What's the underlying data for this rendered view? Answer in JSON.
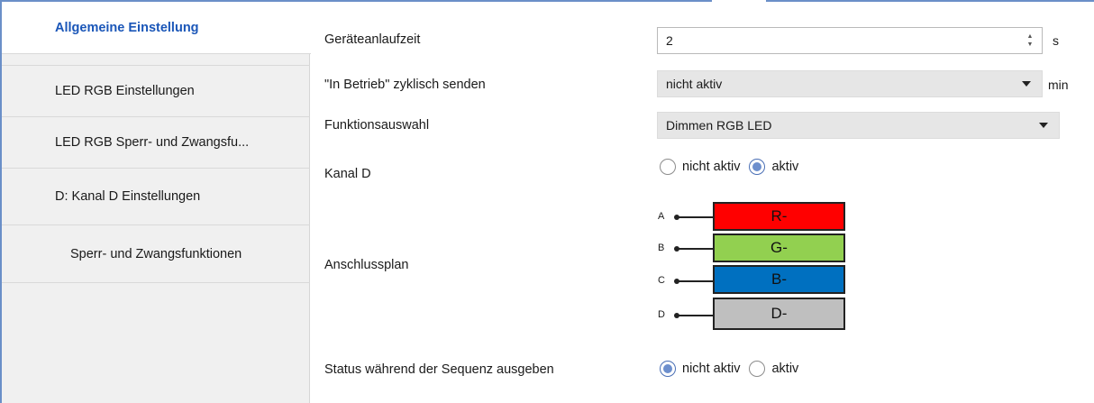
{
  "sidebar": {
    "items": [
      {
        "label": "Allgemeine Einstellung"
      },
      {
        "label": "LED RGB Einstellungen"
      },
      {
        "label": "LED RGB Sperr- und Zwangsfu..."
      },
      {
        "label": "D: Kanal D Einstellungen"
      },
      {
        "label": "Sperr- und Zwangsfunktionen"
      }
    ]
  },
  "settings": {
    "startup_time": {
      "label": "Geräteanlaufzeit",
      "value": "2",
      "unit": "s"
    },
    "cyclic_send": {
      "label": "\"In Betrieb\" zyklisch senden",
      "value": "nicht aktiv",
      "unit": "min"
    },
    "function_select": {
      "label": "Funktionsauswahl",
      "value": "Dimmen RGB LED"
    },
    "channel_d": {
      "label": "Kanal D",
      "options": [
        "nicht aktiv",
        "aktiv"
      ],
      "selected": "aktiv"
    },
    "wiring": {
      "label": "Anschlussplan",
      "pins": [
        "A",
        "B",
        "C",
        "D"
      ],
      "bars": [
        {
          "label": "R-",
          "color": "#ff0000"
        },
        {
          "label": "G-",
          "color": "#92d050"
        },
        {
          "label": "B-",
          "color": "#0070c0"
        },
        {
          "label": "D-",
          "color": "#bfbfbf"
        }
      ]
    },
    "status_sequence": {
      "label": "Status während der Sequenz ausgeben",
      "options": [
        "nicht aktiv",
        "aktiv"
      ],
      "selected": "nicht aktiv"
    }
  }
}
